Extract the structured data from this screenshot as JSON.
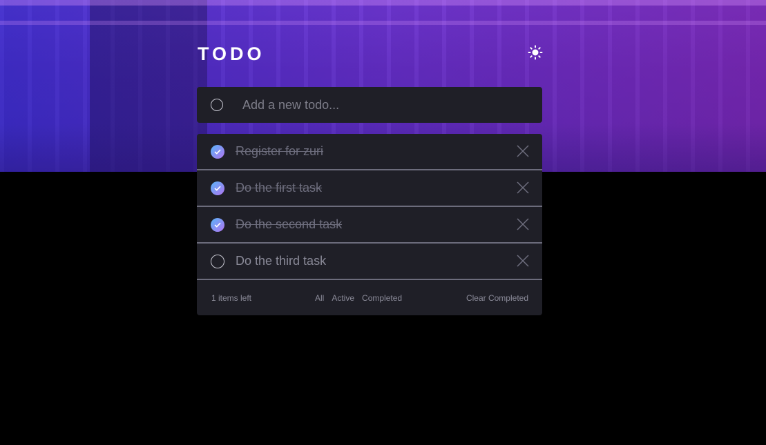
{
  "header": {
    "title": "TODO",
    "theme_icon": "sun-icon"
  },
  "new_todo": {
    "placeholder": "Add a new todo..."
  },
  "todos": [
    {
      "text": "Register for zuri",
      "completed": true
    },
    {
      "text": "Do the first task",
      "completed": true
    },
    {
      "text": "Do the second task",
      "completed": true
    },
    {
      "text": "Do the third task",
      "completed": false
    }
  ],
  "footer": {
    "items_left": "1 items left",
    "filters": {
      "all": "All",
      "active": "Active",
      "completed": "Completed"
    },
    "clear_completed": "Clear Completed"
  },
  "colors": {
    "accent_gradient_start": "#58b4f8",
    "accent_gradient_end": "#b174f0",
    "card_background": "#1f1f27",
    "page_background": "#000000"
  }
}
